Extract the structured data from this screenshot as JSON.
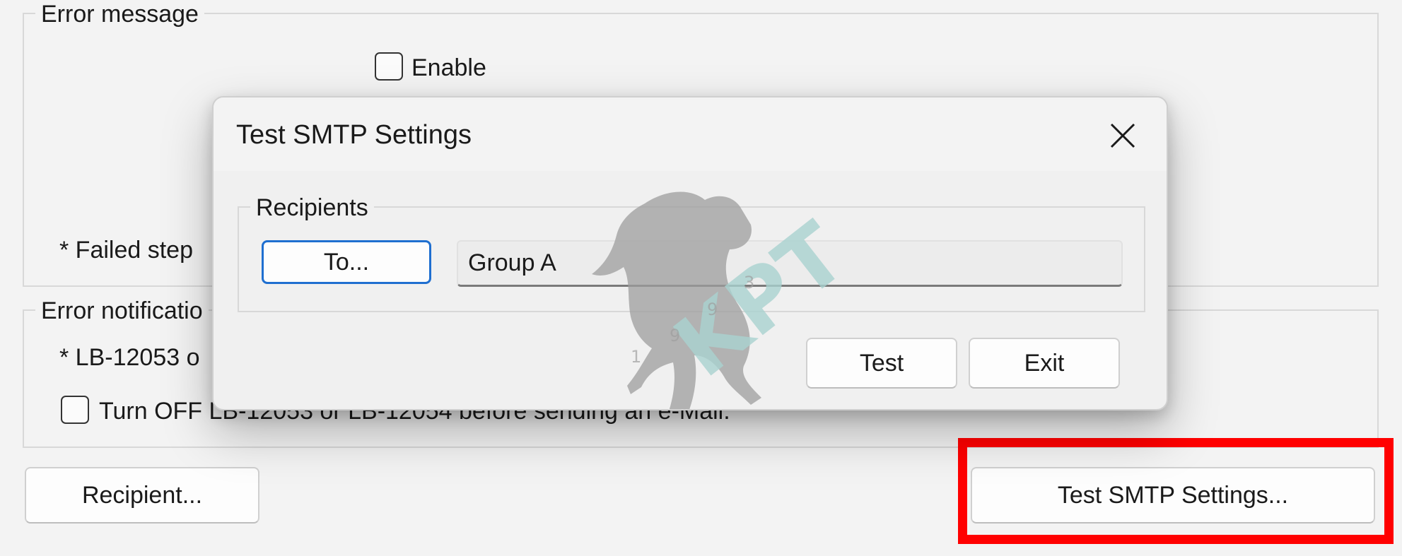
{
  "error_message_group": {
    "legend": "Error message",
    "enable_label": "Enable",
    "failed_step_note": "* Failed step"
  },
  "error_notification_group": {
    "legend": "Error notificatio",
    "lb_note": "* LB-12053 o",
    "turn_off_label": "Turn OFF LB-12053 or LB-12054 before sending an e-Mail."
  },
  "buttons": {
    "recipient": "Recipient...",
    "test_smtp": "Test SMTP Settings..."
  },
  "dialog": {
    "title": "Test SMTP Settings",
    "recipients_legend": "Recipients",
    "to_button": "To...",
    "recipients_value": "Group A",
    "test_button": "Test",
    "exit_button": "Exit"
  },
  "watermark": {
    "text": "KPT",
    "digits": [
      "1",
      "9",
      "9",
      "3"
    ],
    "colors": {
      "text": "#a9d2cf",
      "horse": "#9e9e9e"
    }
  },
  "colors": {
    "highlight": "#ff0000",
    "focus_border": "#1f6fd0",
    "background": "#f3f3f3"
  },
  "icons": {
    "close": "close-icon"
  }
}
